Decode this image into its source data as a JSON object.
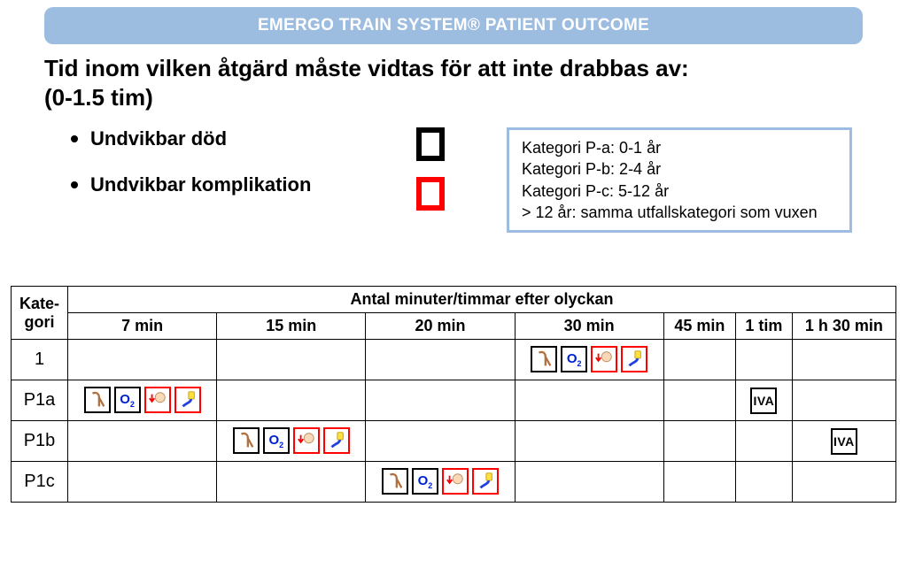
{
  "banner": "EMERGO TRAIN SYSTEM® PATIENT OUTCOME",
  "intro_line1": "Tid inom vilken åtgärd måste vidtas för att inte drabbas av:",
  "intro_line2": "(0-1.5 tim)",
  "bullets": {
    "death": "Undvikbar död",
    "complication": "Undvikbar komplikation"
  },
  "categories_box": {
    "a": "Kategori P-a: 0-1 år",
    "b": "Kategori P-b: 2-4 år",
    "c": "Kategori P-c: 5-12 år",
    "d": "> 12 år: samma utfallskategori som vuxen"
  },
  "table": {
    "corner": "Kate-\ngori",
    "header_span": "Antal minuter/timmar efter olyckan",
    "cols": [
      "7 min",
      "15 min",
      "20 min",
      "30 min",
      "45 min",
      "1 tim",
      "1 h 30 min"
    ],
    "rows": [
      {
        "label": "1",
        "cells": [
          "",
          "",
          "",
          "ICONS",
          "",
          "",
          ""
        ]
      },
      {
        "label": "P1a",
        "cells": [
          "ICONS",
          "",
          "",
          "",
          "",
          "IVA",
          ""
        ]
      },
      {
        "label": "P1b",
        "cells": [
          "",
          "ICONS",
          "",
          "",
          "",
          "",
          "IVA"
        ]
      },
      {
        "label": "P1c",
        "cells": [
          "",
          "",
          "ICONS",
          "",
          "",
          "",
          ""
        ]
      }
    ]
  },
  "iva_label": "IVA"
}
